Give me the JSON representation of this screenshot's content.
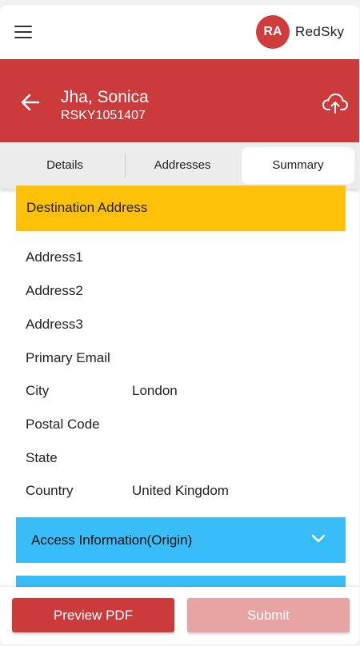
{
  "app": {
    "avatar_initials": "RA",
    "brand": "RedSky"
  },
  "header": {
    "name": "Jha, Sonica",
    "code": "RSKY1051407"
  },
  "tabs": [
    {
      "label": "Details"
    },
    {
      "label": "Addresses"
    },
    {
      "label": "Summary",
      "active": true
    }
  ],
  "destination": {
    "title": "Destination Address",
    "rows": [
      {
        "label": "Address1",
        "value": ""
      },
      {
        "label": "Address2",
        "value": ""
      },
      {
        "label": "Address3",
        "value": ""
      },
      {
        "label": "Primary Email",
        "value": ""
      },
      {
        "label": "City",
        "value": "London"
      },
      {
        "label": "Postal Code",
        "value": ""
      },
      {
        "label": "State",
        "value": ""
      },
      {
        "label": "Country",
        "value": "United Kingdom"
      }
    ]
  },
  "access": {
    "title": "Access Information(Origin)"
  },
  "footer": {
    "preview_label": "Preview PDF",
    "submit_label": "Submit"
  },
  "colors": {
    "primary_red": "#cc3b3b",
    "section_yellow": "#ffc107",
    "section_blue": "#38bdf8",
    "disabled_red": "#e8a3a3"
  },
  "icons": [
    "hamburger-menu-icon",
    "back-arrow-icon",
    "cloud-upload-icon",
    "chevron-down-icon"
  ]
}
